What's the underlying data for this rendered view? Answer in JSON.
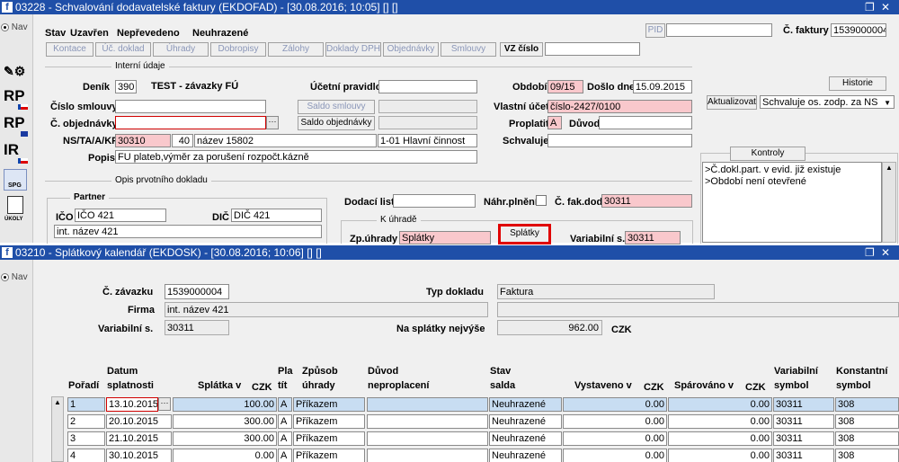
{
  "top": {
    "title": "03228 - Schvalování dodavatelské faktury (EKDOFAD) - [30.08.2016; 10:05] [] []",
    "nav_label": "Nav",
    "stav_label": "Stav",
    "stav_value": "Uzavřen",
    "neprevedeno": "Nepřevedeno",
    "neprazene": "Neuhrazené",
    "pid_label": "PID",
    "faktura_label": "Č. faktury",
    "faktura_value": "1539000004",
    "toolbar": [
      "Kontace",
      "Úč. doklad",
      "Úhrady",
      "Dobropisy",
      "Zálohy",
      "Doklady DPH",
      "Objednávky",
      "Smlouvy"
    ],
    "vz_cislo": "VZ číslo",
    "interni_udaje": "Interní údaje",
    "historie": "Historie",
    "denik_label": "Deník",
    "denik_code": "390",
    "denik_name": "TEST - závazky FÚ",
    "ucetni_pravidlo": "Účetní pravidlo",
    "obdobi_label": "Období",
    "obdobi_value": "09/15",
    "doslo_label": "Došlo dne",
    "doslo_value": "15.09.2015",
    "aktualizovat": "Aktualizovat",
    "schvaluje_select": "Schvaluje os. zodp. za NS",
    "cislo_smlouvy": "Číslo smlouvy",
    "saldo_smlouvy": "Saldo smlouvy",
    "vlastni_ucet_label": "Vlastní účet",
    "vlastni_ucet_value": "číslo-2427/0100",
    "c_objednavky": "Č. objednávky",
    "saldo_objednavky": "Saldo objednávky",
    "proplatit_label": "Proplatit",
    "proplatit_value": "A",
    "duvod_label": "Důvod",
    "ns_label": "NS/TA/A/KP",
    "ns_value": "30310",
    "ta_value": "40",
    "ta_name": "název 15802",
    "kp_value": "1-01 Hlavní činnost",
    "schvaluje_label": "Schvaluje",
    "popis_label": "Popis",
    "popis_value": "FU plateb,výměr za porušení rozpočt.kázně",
    "kontroly": "Kontroly",
    "kontroly_items": [
      ">Č.dokl.part. v evid. již existuje",
      ">Období není otevřené"
    ],
    "opis_label": "Opis prvotního dokladu",
    "partner_label": "Partner",
    "ico_label": "IČO",
    "ico_value": "IČO 421",
    "dic_label": "DIČ",
    "dic_value": "DIČ 421",
    "partner_name": "int. název 421",
    "dodaci_list": "Dodací list",
    "nahr_plneni": "Náhr.plnění",
    "c_fak_dod_label": "Č. fak.dod",
    "c_fak_dod_value": "30311",
    "k_uhrade": "K úhradě",
    "zp_uhrady_label": "Zp.úhrady",
    "zp_uhrady_value": "Splátky",
    "splatky_button": "Splátky",
    "variabilni_label": "Variabilní s.",
    "variabilni_value": "30311"
  },
  "bottom": {
    "title": "03210 - Splátkový kalendář (EKDOSK) - [30.08.2016; 10:06] [] []",
    "nav_label": "Nav",
    "c_zavazku_label": "Č. závazku",
    "c_zavazku_value": "1539000004",
    "typ_dokladu_label": "Typ dokladu",
    "typ_dokladu_value": "Faktura",
    "firma_label": "Firma",
    "firma_value": "int. název 421",
    "variabilni_label": "Variabilní s.",
    "variabilni_value": "30311",
    "na_splatky_label": "Na splátky nejvýše",
    "na_splatky_value": "962.00",
    "czk": "CZK",
    "headers": {
      "poradi": "Pořadí",
      "datum1": "Datum",
      "datum2": "splatnosti",
      "splatka": "Splátka v",
      "czk": "CZK",
      "pla1": "Pla",
      "pla2": "tít",
      "zpusob1": "Způsob",
      "zpusob2": "úhrady",
      "duvod1": "Důvod",
      "duvod2": "neproplacení",
      "stav1": "Stav",
      "stav2": "salda",
      "vystaveno": "Vystaveno v",
      "parovano": "Spárováno v",
      "var1": "Variabilní",
      "var2": "symbol",
      "konst1": "Konstantní",
      "konst2": "symbol"
    },
    "rows": [
      {
        "poradi": "1",
        "datum": "13.10.2015",
        "splatka": "100.00",
        "pla": "A",
        "zpusob": "Příkazem",
        "duvod": "",
        "stav": "Neuhrazené",
        "vystaveno": "0.00",
        "parovano": "0.00",
        "var": "30311",
        "konst": "308"
      },
      {
        "poradi": "2",
        "datum": "20.10.2015",
        "splatka": "300.00",
        "pla": "A",
        "zpusob": "Příkazem",
        "duvod": "",
        "stav": "Neuhrazené",
        "vystaveno": "0.00",
        "parovano": "0.00",
        "var": "30311",
        "konst": "308"
      },
      {
        "poradi": "3",
        "datum": "21.10.2015",
        "splatka": "300.00",
        "pla": "A",
        "zpusob": "Příkazem",
        "duvod": "",
        "stav": "Neuhrazené",
        "vystaveno": "0.00",
        "parovano": "0.00",
        "var": "30311",
        "konst": "308"
      },
      {
        "poradi": "4",
        "datum": "30.10.2015",
        "splatka": "0.00",
        "pla": "A",
        "zpusob": "Příkazem",
        "duvod": "",
        "stav": "Neuhrazené",
        "vystaveno": "0.00",
        "parovano": "0.00",
        "var": "30311",
        "konst": "308"
      }
    ]
  },
  "sidebar_icons": [
    "tools-icon",
    "rp-cz-icon",
    "rp-eu-icon",
    "ir-cz-icon",
    "spg-icon",
    "ukoly-icon"
  ],
  "sidebar_labels": [
    "RP",
    "RP",
    "IR",
    "SPG",
    "ÚKOLY"
  ],
  "colors": {
    "titlebar": "#1f4fa8",
    "pink": "#f9c8cc",
    "selected_row": "#c8ddf2",
    "highlight": "#e00000"
  }
}
